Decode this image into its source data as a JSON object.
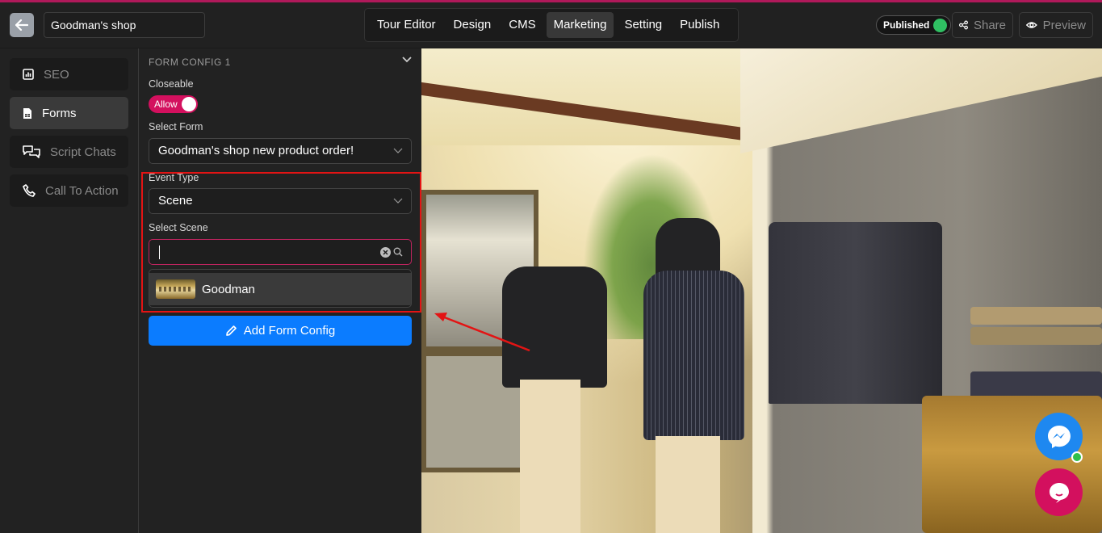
{
  "header": {
    "back_icon": "arrow-left-icon",
    "project_title": "Goodman's shop",
    "nav_tabs": [
      {
        "label": "Tour Editor",
        "active": false
      },
      {
        "label": "Design",
        "active": false
      },
      {
        "label": "CMS",
        "active": false
      },
      {
        "label": "Marketing",
        "active": true
      },
      {
        "label": "Setting",
        "active": false
      },
      {
        "label": "Publish",
        "active": false
      }
    ],
    "status_label": "Published",
    "status_color": "#2fbf62",
    "share_label": "Share",
    "preview_label": "Preview",
    "accent_color": "#b0195a"
  },
  "sidebar": {
    "items": [
      {
        "label": "SEO",
        "icon": "chart-icon",
        "active": false
      },
      {
        "label": "Forms",
        "icon": "form-icon",
        "active": true
      },
      {
        "label": "Script Chats",
        "icon": "chat-bubbles-icon",
        "active": false
      },
      {
        "label": "Call To Action",
        "icon": "phone-icon",
        "active": false
      }
    ]
  },
  "form_config": {
    "section_title": "FORM CONFIG 1",
    "closeable_label": "Closeable",
    "closeable_toggle_label": "Allow",
    "closeable_enabled": true,
    "select_form_label": "Select Form",
    "select_form_value": "Goodman's shop new product order!",
    "event_type_label": "Event Type",
    "event_type_value": "Scene",
    "select_scene_label": "Select Scene",
    "scene_search_value": "",
    "scene_options": [
      {
        "label": "Goodman"
      }
    ],
    "add_button_label": "Add Form Config",
    "add_button_color": "#0b7cff",
    "toggle_color": "#d3105e"
  },
  "widgets": {
    "messenger_color": "#1e88f0",
    "chat_color": "#d3105e"
  }
}
